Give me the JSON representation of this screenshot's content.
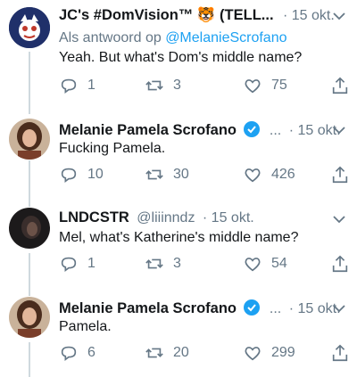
{
  "tweets": [
    {
      "name": "JC's #DomVision™ 🐯 (TELL...",
      "dot": "·",
      "time": "15 okt.",
      "reply_prefix": "Als antwoord op",
      "reply_handle": "@MelanieScrofano",
      "text": "Yeah. But what's Dom's middle name?",
      "replies": "1",
      "retweets": "3",
      "likes": "75"
    },
    {
      "name": "Melanie Pamela Scrofano",
      "name_overflow": "...",
      "dot": "·",
      "time": "15 okt.",
      "text": "Fucking Pamela.",
      "replies": "10",
      "retweets": "30",
      "likes": "426"
    },
    {
      "name": "LNDCSTR",
      "handle": "@liiinndz",
      "dot": "·",
      "time": "15 okt.",
      "text": "Mel, what's Katherine's middle name?",
      "replies": "1",
      "retweets": "3",
      "likes": "54"
    },
    {
      "name": "Melanie Pamela Scrofano",
      "name_overflow": "...",
      "dot": "·",
      "time": "15 okt.",
      "text": "Pamela.",
      "replies": "6",
      "retweets": "20",
      "likes": "299"
    }
  ],
  "colors": {
    "accent": "#1da1f2",
    "muted": "#657786",
    "thread": "#cfd9de"
  }
}
